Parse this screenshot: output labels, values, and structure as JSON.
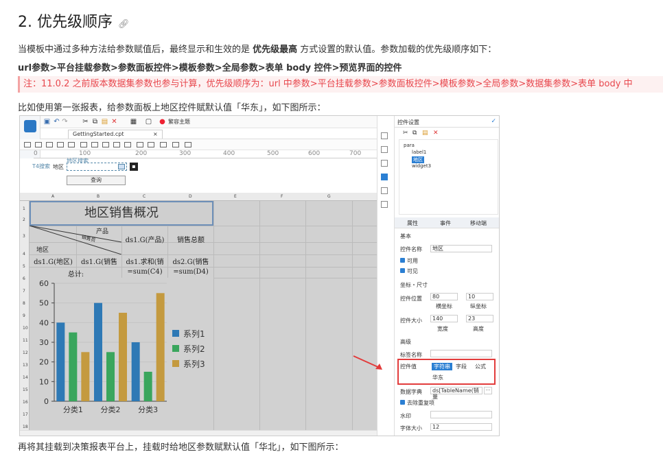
{
  "heading": {
    "title": "2. 优先级顺序",
    "anchor_icon": "link-icon"
  },
  "para1": {
    "prefix": "当模板中通过多种方法给参数赋值后，最终显示和生效的是 ",
    "bold": "优先级最高",
    "suffix": " 方式设置的默认值。参数加载的优先级顺序如下："
  },
  "para2": "url参数>平台挂载参数>参数面板控件>模板参数>全局参数>表单 body 控件>预览界面的控件",
  "note": "注：11.0.2 之前版本数据集参数也参与计算，优先级顺序为：url 中参数>平台挂载参数>参数面板控件>模板参数>全局参数>数据集参数>表单 body 中",
  "para3": "比如使用第一张报表，给参数面板上地区控件赋默认值「华东」，如下图所示：",
  "para4": "再将其挂载到决策报表平台上，挂载时给地区参数赋默认值「华北」，如下图所示：",
  "shot": {
    "toolbar_label": "繁容主题",
    "tab_label": "GettingStarted.cpt",
    "ruler": [
      "0",
      "100",
      "200",
      "300",
      "400",
      "500",
      "600",
      "700"
    ],
    "param_tag": "T4搜索",
    "param_label": "地区",
    "param_name_tag": "地区搜索",
    "query_button": "查询",
    "col_headers": [
      "A",
      "B",
      "C",
      "D",
      "E",
      "F",
      "G"
    ],
    "row_headers": [
      "1",
      "2",
      "3",
      "4",
      "5",
      "6",
      "7",
      "8",
      "9",
      "10",
      "11",
      "12",
      "13",
      "14",
      "15",
      "16",
      "17",
      "18"
    ],
    "report_title": "地区销售概况",
    "cells": {
      "product": "产品",
      "sales": "销售员",
      "region": "地区",
      "c3": "ds1.G(产品)",
      "d3": "销售总额",
      "a4": "ds1.G(地区)",
      "b4": "ds1.G(销售",
      "c4": "ds1.求和(销",
      "d4": "ds2.G(销售",
      "total": "总计:",
      "c5": "=sum(C4)",
      "d5": "=sum(D4)"
    },
    "right_panel": {
      "title": "控件设置",
      "tree": [
        "para",
        "label1",
        "地区",
        "widget3"
      ],
      "tabs": [
        "属性",
        "事件",
        "移动端"
      ],
      "sect_basic": "基本",
      "name_label": "控件名称",
      "name_value": "地区",
      "cb_enabled": "可用",
      "cb_visible": "可见",
      "sect_pos": "坐标・尺寸",
      "pos_label": "控件位置",
      "pos_x": "80",
      "pos_y": "10",
      "pos_x_caption": "横坐标",
      "pos_y_caption": "纵坐标",
      "size_label": "控件大小",
      "size_w": "140",
      "size_h": "23",
      "size_w_caption": "宽度",
      "size_h_caption": "高度",
      "sect_adv": "高级",
      "tag_label": "标签名称",
      "value_label": "控件值",
      "value_chips": [
        "字符串",
        "字段",
        "公式"
      ],
      "value_text": "华东",
      "dict_label": "数据字典",
      "dict_value": "ds[TableName(销量",
      "dedupe": "去除重复项",
      "watermark_label": "水印",
      "fontsize_label": "字体大小",
      "fontsize_value": "12"
    }
  },
  "chart_data": {
    "type": "bar",
    "categories": [
      "分类1",
      "分类2",
      "分类3"
    ],
    "series": [
      {
        "name": "系列1",
        "values": [
          40,
          50,
          30
        ],
        "color": "#2e79b5"
      },
      {
        "name": "系列2",
        "values": [
          35,
          25,
          15
        ],
        "color": "#3aa65d"
      },
      {
        "name": "系列3",
        "values": [
          25,
          45,
          55
        ],
        "color": "#c49a3f"
      }
    ],
    "yticks": [
      0,
      10,
      20,
      30,
      40,
      50,
      60
    ],
    "ylim": [
      0,
      60
    ],
    "legend": "right"
  }
}
